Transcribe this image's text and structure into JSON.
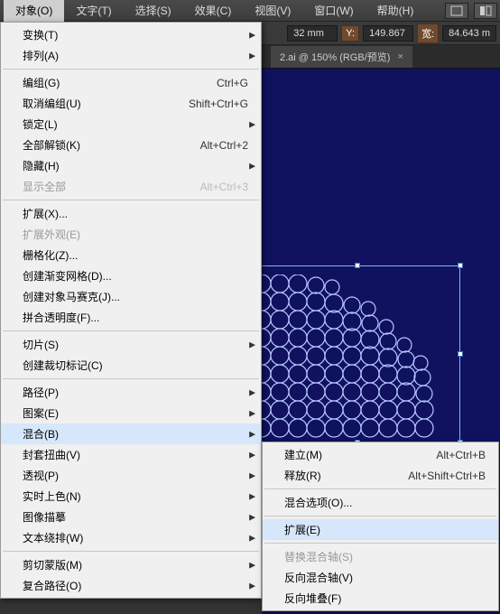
{
  "menubar": {
    "items": [
      "对象(O)",
      "文字(T)",
      "选择(S)",
      "效果(C)",
      "视图(V)",
      "窗口(W)",
      "帮助(H)"
    ]
  },
  "propbar": {
    "val1": "32 mm",
    "label_y": "Y:",
    "val_y": "149.867 ",
    "label_w": "宽:",
    "val_w": "84.643 m"
  },
  "doctab": {
    "title": "2.ai @ 150% (RGB/预览)",
    "close": "×"
  },
  "menu1": [
    {
      "label": "变换(T)",
      "sub": true
    },
    {
      "label": "排列(A)",
      "sub": true
    },
    {
      "sep": true
    },
    {
      "label": "编组(G)",
      "short": "Ctrl+G"
    },
    {
      "label": "取消编组(U)",
      "short": "Shift+Ctrl+G"
    },
    {
      "label": "锁定(L)",
      "sub": true
    },
    {
      "label": "全部解锁(K)",
      "short": "Alt+Ctrl+2"
    },
    {
      "label": "隐藏(H)",
      "sub": true
    },
    {
      "label": "显示全部",
      "short": "Alt+Ctrl+3",
      "disabled": true
    },
    {
      "sep": true
    },
    {
      "label": "扩展(X)..."
    },
    {
      "label": "扩展外观(E)",
      "disabled": true
    },
    {
      "label": "栅格化(Z)..."
    },
    {
      "label": "创建渐变网格(D)..."
    },
    {
      "label": "创建对象马赛克(J)..."
    },
    {
      "label": "拼合透明度(F)..."
    },
    {
      "sep": true
    },
    {
      "label": "切片(S)",
      "sub": true
    },
    {
      "label": "创建裁切标记(C)"
    },
    {
      "sep": true
    },
    {
      "label": "路径(P)",
      "sub": true
    },
    {
      "label": "图案(E)",
      "sub": true
    },
    {
      "label": "混合(B)",
      "sub": true,
      "highlight": true
    },
    {
      "label": "封套扭曲(V)",
      "sub": true
    },
    {
      "label": "透视(P)",
      "sub": true
    },
    {
      "label": "实时上色(N)",
      "sub": true
    },
    {
      "label": "图像描摹",
      "sub": true
    },
    {
      "label": "文本绕排(W)",
      "sub": true
    },
    {
      "sep": true
    },
    {
      "label": "剪切蒙版(M)",
      "sub": true
    },
    {
      "label": "复合路径(O)",
      "sub": true
    }
  ],
  "menu2": [
    {
      "label": "建立(M)",
      "short": "Alt+Ctrl+B"
    },
    {
      "label": "释放(R)",
      "short": "Alt+Shift+Ctrl+B"
    },
    {
      "sep": true
    },
    {
      "label": "混合选项(O)..."
    },
    {
      "sep": true
    },
    {
      "label": "扩展(E)",
      "highlight": true
    },
    {
      "sep": true
    },
    {
      "label": "替换混合轴(S)",
      "disabled": true
    },
    {
      "label": "反向混合轴(V)"
    },
    {
      "label": "反向堆叠(F)"
    }
  ]
}
